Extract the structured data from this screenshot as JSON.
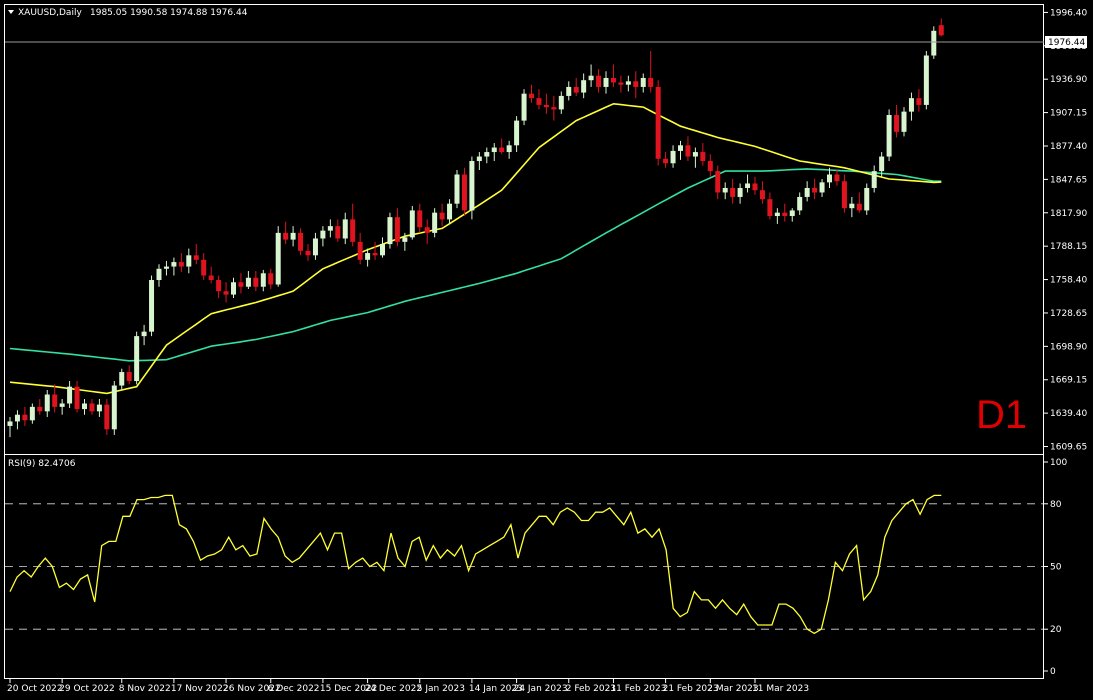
{
  "header": {
    "title": "XAUUSD,Daily",
    "ohlc": "1985.05 1990.58 1974.88 1976.44"
  },
  "timeframe_label": "D1",
  "rsi_label": "RSI(9) 82.4706",
  "current_price_label": "1976.44",
  "colors": {
    "background": "#000000",
    "up": "#d8f5d0",
    "down": "#e0141e",
    "ma_fast": "#ffff33",
    "ma_slow": "#33e0a0",
    "rsi": "#ffff33",
    "grid": "#ffffff",
    "text": "#ffffff",
    "label": "#e00000"
  },
  "chart_data": [
    {
      "type": "candlestick",
      "title": "XAUUSD,Daily",
      "ylim": [
        1603,
        2003
      ],
      "y_ticks": [
        "1996.40",
        "1966.65",
        "1936.90",
        "1907.15",
        "1877.40",
        "1847.65",
        "1817.90",
        "1788.15",
        "1758.40",
        "1728.65",
        "1698.90",
        "1669.15",
        "1639.40",
        "1609.65"
      ],
      "x_ticks": [
        {
          "label": "20 Oct 2022",
          "index": 0
        },
        {
          "label": "29 Oct 2022",
          "index": 7
        },
        {
          "label": "8 Nov 2022",
          "index": 15
        },
        {
          "label": "17 Nov 2022",
          "index": 22
        },
        {
          "label": "26 Nov 2022",
          "index": 29
        },
        {
          "label": "6 Dec 2022",
          "index": 35
        },
        {
          "label": "15 Dec 2022",
          "index": 42
        },
        {
          "label": "24 Dec 2022",
          "index": 48
        },
        {
          "label": "5 Jan 2023",
          "index": 55
        },
        {
          "label": "14 Jan 2023",
          "index": 62
        },
        {
          "label": "24 Jan 2023",
          "index": 68
        },
        {
          "label": "2 Feb 2023",
          "index": 75
        },
        {
          "label": "11 Feb 2023",
          "index": 81
        },
        {
          "label": "21 Feb 2023",
          "index": 88
        },
        {
          "label": "2 Mar 2023",
          "index": 94
        },
        {
          "label": "11 Mar 2023",
          "index": 100
        }
      ],
      "candles": [
        [
          1628,
          1636,
          1618,
          1632
        ],
        [
          1632,
          1642,
          1625,
          1638
        ],
        [
          1638,
          1645,
          1628,
          1633
        ],
        [
          1633,
          1648,
          1630,
          1645
        ],
        [
          1645,
          1652,
          1638,
          1641
        ],
        [
          1641,
          1660,
          1636,
          1656
        ],
        [
          1656,
          1665,
          1640,
          1645
        ],
        [
          1645,
          1652,
          1638,
          1648
        ],
        [
          1648,
          1668,
          1644,
          1663
        ],
        [
          1663,
          1668,
          1640,
          1643
        ],
        [
          1643,
          1652,
          1638,
          1648
        ],
        [
          1648,
          1652,
          1638,
          1641
        ],
        [
          1641,
          1652,
          1636,
          1647
        ],
        [
          1647,
          1652,
          1620,
          1625
        ],
        [
          1625,
          1668,
          1620,
          1664
        ],
        [
          1664,
          1679,
          1660,
          1676
        ],
        [
          1676,
          1682,
          1665,
          1668
        ],
        [
          1668,
          1712,
          1665,
          1708
        ],
        [
          1708,
          1718,
          1700,
          1712
        ],
        [
          1712,
          1762,
          1708,
          1758
        ],
        [
          1758,
          1772,
          1752,
          1768
        ],
        [
          1768,
          1775,
          1762,
          1770
        ],
        [
          1770,
          1778,
          1762,
          1774
        ],
        [
          1774,
          1782,
          1765,
          1770
        ],
        [
          1770,
          1786,
          1764,
          1780
        ],
        [
          1780,
          1790,
          1772,
          1776
        ],
        [
          1776,
          1782,
          1758,
          1762
        ],
        [
          1762,
          1770,
          1755,
          1758
        ],
        [
          1758,
          1762,
          1742,
          1748
        ],
        [
          1748,
          1756,
          1738,
          1745
        ],
        [
          1745,
          1760,
          1742,
          1756
        ],
        [
          1756,
          1764,
          1746,
          1752
        ],
        [
          1752,
          1766,
          1750,
          1760
        ],
        [
          1760,
          1766,
          1748,
          1752
        ],
        [
          1752,
          1767,
          1748,
          1764
        ],
        [
          1764,
          1768,
          1750,
          1754
        ],
        [
          1754,
          1806,
          1752,
          1800
        ],
        [
          1800,
          1810,
          1790,
          1794
        ],
        [
          1794,
          1806,
          1788,
          1800
        ],
        [
          1800,
          1804,
          1780,
          1784
        ],
        [
          1784,
          1790,
          1775,
          1780
        ],
        [
          1780,
          1800,
          1776,
          1795
        ],
        [
          1795,
          1806,
          1788,
          1802
        ],
        [
          1802,
          1812,
          1796,
          1806
        ],
        [
          1806,
          1812,
          1792,
          1795
        ],
        [
          1795,
          1818,
          1790,
          1812
        ],
        [
          1812,
          1826,
          1788,
          1792
        ],
        [
          1792,
          1800,
          1772,
          1776
        ],
        [
          1776,
          1786,
          1770,
          1782
        ],
        [
          1782,
          1792,
          1776,
          1780
        ],
        [
          1780,
          1796,
          1778,
          1790
        ],
        [
          1790,
          1818,
          1786,
          1814
        ],
        [
          1814,
          1822,
          1788,
          1792
        ],
        [
          1792,
          1800,
          1784,
          1796
        ],
        [
          1796,
          1824,
          1794,
          1820
        ],
        [
          1820,
          1826,
          1800,
          1805
        ],
        [
          1805,
          1812,
          1790,
          1800
        ],
        [
          1800,
          1822,
          1796,
          1818
        ],
        [
          1818,
          1826,
          1806,
          1812
        ],
        [
          1812,
          1830,
          1808,
          1826
        ],
        [
          1826,
          1856,
          1822,
          1852
        ],
        [
          1852,
          1858,
          1815,
          1820
        ],
        [
          1820,
          1868,
          1812,
          1864
        ],
        [
          1864,
          1872,
          1856,
          1868
        ],
        [
          1868,
          1876,
          1862,
          1872
        ],
        [
          1872,
          1880,
          1864,
          1876
        ],
        [
          1876,
          1884,
          1870,
          1872
        ],
        [
          1872,
          1882,
          1866,
          1878
        ],
        [
          1878,
          1904,
          1872,
          1900
        ],
        [
          1900,
          1928,
          1896,
          1924
        ],
        [
          1924,
          1932,
          1916,
          1920
        ],
        [
          1920,
          1928,
          1910,
          1914
        ],
        [
          1914,
          1924,
          1906,
          1912
        ],
        [
          1912,
          1922,
          1900,
          1910
        ],
        [
          1910,
          1926,
          1906,
          1922
        ],
        [
          1922,
          1935,
          1918,
          1930
        ],
        [
          1930,
          1938,
          1922,
          1925
        ],
        [
          1925,
          1942,
          1920,
          1936
        ],
        [
          1936,
          1950,
          1930,
          1940
        ],
        [
          1940,
          1946,
          1925,
          1930
        ],
        [
          1930,
          1944,
          1924,
          1938
        ],
        [
          1938,
          1950,
          1930,
          1934
        ],
        [
          1934,
          1940,
          1925,
          1932
        ],
        [
          1932,
          1940,
          1926,
          1935
        ],
        [
          1935,
          1944,
          1920,
          1930
        ],
        [
          1930,
          1942,
          1925,
          1938
        ],
        [
          1938,
          1962,
          1925,
          1930
        ],
        [
          1930,
          1936,
          1860,
          1866
        ],
        [
          1866,
          1872,
          1858,
          1862
        ],
        [
          1862,
          1878,
          1858,
          1873
        ]
      ],
      "candles_2": [
        [
          1873,
          1882,
          1865,
          1878
        ],
        [
          1878,
          1886,
          1864,
          1868
        ],
        [
          1868,
          1876,
          1858,
          1872
        ],
        [
          1872,
          1880,
          1860,
          1864
        ],
        [
          1864,
          1870,
          1850,
          1855
        ],
        [
          1855,
          1860,
          1830,
          1836
        ],
        [
          1836,
          1845,
          1830,
          1840
        ],
        [
          1840,
          1848,
          1826,
          1832
        ],
        [
          1832,
          1844,
          1826,
          1840
        ],
        [
          1840,
          1852,
          1836,
          1844
        ],
        [
          1844,
          1850,
          1834,
          1838
        ],
        [
          1838,
          1846,
          1826,
          1830
        ],
        [
          1830,
          1836,
          1812,
          1815
        ],
        [
          1815,
          1822,
          1808,
          1818
        ],
        [
          1818,
          1826,
          1810,
          1815
        ],
        [
          1815,
          1822,
          1810,
          1820
        ],
        [
          1820,
          1836,
          1816,
          1832
        ],
        [
          1832,
          1846,
          1828,
          1840
        ],
        [
          1840,
          1848,
          1830,
          1836
        ],
        [
          1836,
          1848,
          1832,
          1845
        ],
        [
          1845,
          1858,
          1840,
          1852
        ],
        [
          1852,
          1856,
          1842,
          1846
        ],
        [
          1846,
          1852,
          1818,
          1822
        ],
        [
          1822,
          1832,
          1814,
          1826
        ],
        [
          1826,
          1836,
          1818,
          1820
        ],
        [
          1820,
          1844,
          1816,
          1840
        ],
        [
          1840,
          1860,
          1836,
          1855
        ],
        [
          1855,
          1872,
          1850,
          1868
        ],
        [
          1868,
          1910,
          1864,
          1905
        ],
        [
          1905,
          1914,
          1885,
          1890
        ],
        [
          1890,
          1912,
          1886,
          1908
        ],
        [
          1908,
          1925,
          1900,
          1920
        ],
        [
          1920,
          1928,
          1908,
          1914
        ],
        [
          1914,
          1962,
          1910,
          1958
        ],
        [
          1958,
          1984,
          1955,
          1980
        ],
        [
          1985,
          1991,
          1975,
          1976
        ]
      ],
      "ma_fast_anchors": [
        [
          0,
          1667
        ],
        [
          6,
          1663
        ],
        [
          13,
          1657
        ],
        [
          17,
          1663
        ],
        [
          21,
          1700
        ],
        [
          27,
          1728
        ],
        [
          33,
          1738
        ],
        [
          38,
          1748
        ],
        [
          42,
          1768
        ],
        [
          48,
          1785
        ],
        [
          53,
          1797
        ],
        [
          58,
          1804
        ],
        [
          63,
          1825
        ],
        [
          66,
          1838
        ],
        [
          71,
          1876
        ],
        [
          76,
          1900
        ],
        [
          81,
          1915
        ],
        [
          85,
          1912
        ],
        [
          90,
          1895
        ],
        [
          95,
          1885
        ],
        [
          100,
          1877
        ],
        [
          106,
          1864
        ],
        [
          112,
          1858
        ],
        [
          118,
          1848
        ],
        [
          124,
          1845
        ],
        [
          128,
          1846
        ],
        [
          132,
          1860
        ],
        [
          136,
          1878
        ],
        [
          139,
          1896
        ]
      ],
      "ma_slow_anchors": [
        [
          0,
          1697
        ],
        [
          8,
          1692
        ],
        [
          16,
          1686
        ],
        [
          21,
          1687
        ],
        [
          27,
          1699
        ],
        [
          33,
          1705
        ],
        [
          38,
          1712
        ],
        [
          43,
          1722
        ],
        [
          48,
          1729
        ],
        [
          53,
          1739
        ],
        [
          58,
          1747
        ],
        [
          63,
          1755
        ],
        [
          68,
          1764
        ],
        [
          74,
          1777
        ],
        [
          80,
          1800
        ],
        [
          86,
          1822
        ],
        [
          91,
          1840
        ],
        [
          96,
          1855
        ],
        [
          101,
          1855
        ],
        [
          107,
          1857
        ],
        [
          113,
          1855
        ],
        [
          119,
          1852
        ],
        [
          124,
          1846
        ],
        [
          130,
          1846
        ],
        [
          135,
          1855
        ],
        [
          139,
          1867
        ]
      ]
    },
    {
      "type": "line",
      "title": "RSI(9) 82.4706",
      "ylim": [
        0,
        100
      ],
      "y_ticks": [
        "100",
        "80",
        "50",
        "20",
        "0"
      ],
      "levels": [
        80,
        50,
        20
      ],
      "values": [
        38,
        45,
        48,
        45,
        50,
        54,
        50,
        40,
        42,
        39,
        44,
        46,
        33,
        60,
        62,
        62,
        74,
        74,
        82,
        82,
        83,
        83,
        84,
        84,
        70,
        68,
        62,
        53,
        55,
        56,
        58,
        64,
        58,
        60,
        55,
        56,
        73,
        68,
        64,
        55,
        52,
        54,
        58,
        62,
        66,
        58,
        66,
        66,
        49,
        52,
        54,
        50,
        52,
        48,
        66,
        54,
        50,
        62,
        64,
        53,
        60,
        54,
        58,
        55,
        60,
        48,
        56,
        58,
        60,
        62,
        64,
        70,
        54,
        66,
        70,
        74,
        74,
        70,
        76,
        78,
        76,
        72,
        72,
        76,
        76,
        78,
        74,
        70,
        76,
        66,
        68,
        64,
        68,
        58,
        30,
        26,
        28,
        38,
        34,
        34,
        30,
        34,
        30,
        27,
        32,
        26,
        22,
        22,
        22,
        32,
        32,
        30,
        26,
        20,
        18,
        20,
        34,
        52,
        48,
        56,
        60,
        34,
        38,
        46,
        64,
        72,
        76,
        80,
        82,
        75,
        82,
        84,
        84
      ],
      "last_value": 82.4706
    }
  ]
}
